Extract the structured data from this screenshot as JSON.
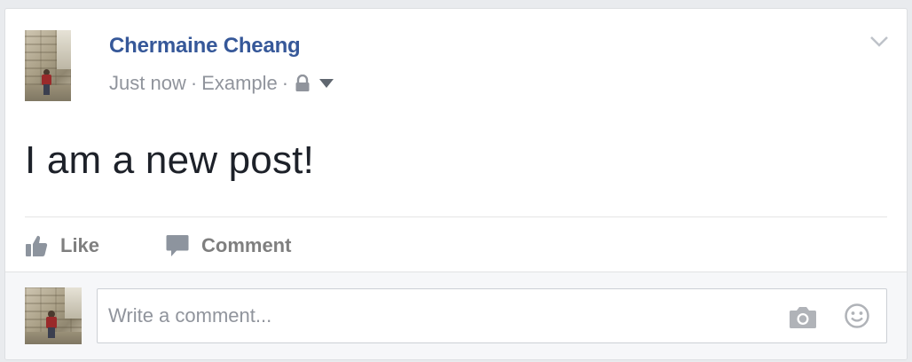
{
  "post": {
    "author": "Chermaine Cheang",
    "time": "Just now",
    "separator": "·",
    "audience": "Example",
    "text": "I am a new post!"
  },
  "actions": {
    "like_label": "Like",
    "comment_label": "Comment"
  },
  "comment_box": {
    "placeholder": "Write a comment..."
  },
  "icons": {
    "options": "chevron-down-icon",
    "privacy": "lock-icon",
    "privacy_menu": "caret-down-icon",
    "like": "thumbs-up-icon",
    "comment": "speech-bubble-icon",
    "photo": "camera-icon",
    "emoji": "smiley-icon"
  },
  "colors": {
    "author_link": "#365899",
    "meta_text": "#90949c",
    "action_text": "#7f7f7f",
    "post_text": "#1d2129",
    "page_background": "#e9ebee"
  }
}
